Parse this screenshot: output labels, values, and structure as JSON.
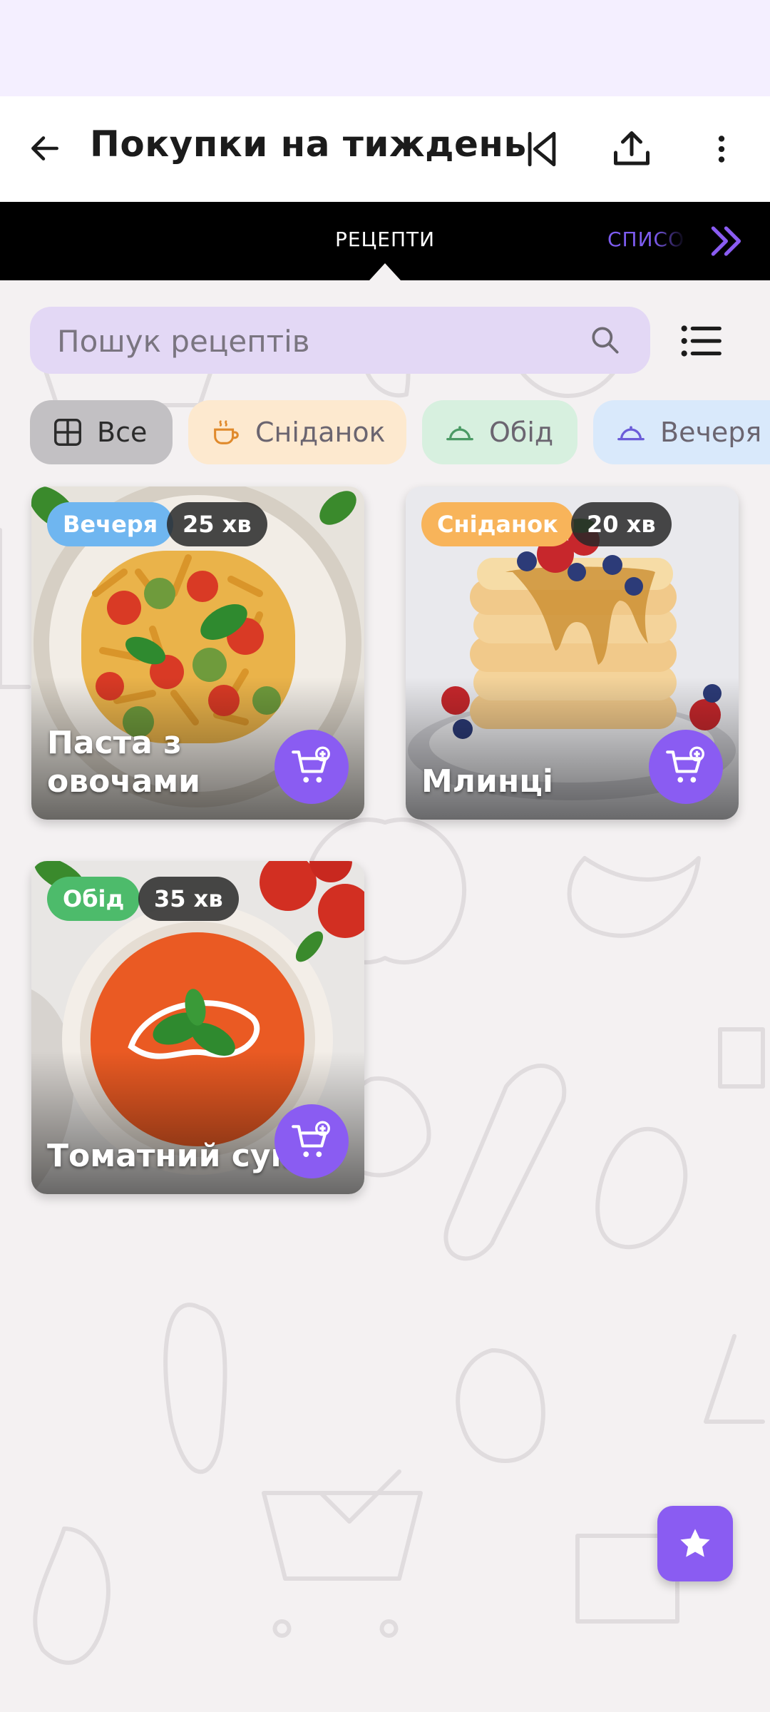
{
  "app_bar": {
    "title": "Покупки на тиждень",
    "icons": [
      "back-arrow-icon",
      "skip-back-icon",
      "share-icon",
      "more-vert-icon"
    ]
  },
  "tabs": {
    "active": "РЕЦЕПТИ",
    "next": "СПИСОК",
    "more_icon": "double-chevron-right-icon"
  },
  "search": {
    "placeholder": "Пошук рецептів"
  },
  "filters": [
    {
      "label": "Все",
      "icon": "grid-icon",
      "selected": true
    },
    {
      "label": "Сніданок",
      "icon": "coffee-cup-icon"
    },
    {
      "label": "Обід",
      "icon": "cloche-icon"
    },
    {
      "label": "Вечеря",
      "icon": "cloche-icon"
    }
  ],
  "recipes": [
    {
      "name": "Паста з овочами",
      "category": "Вечеря",
      "category_color": "#6fb6f0",
      "time": "25 хв"
    },
    {
      "name": "Млинці",
      "category": "Сніданок",
      "category_color": "#f8b45a",
      "time": "20 хв"
    },
    {
      "name": "Томатний суп",
      "category": "Обід",
      "category_color": "#4dbb6b",
      "time": "35 хв"
    }
  ],
  "colors": {
    "accent": "#8a5cf2",
    "search_bg": "#e3d8f5"
  },
  "fab_icon": "star-icon"
}
